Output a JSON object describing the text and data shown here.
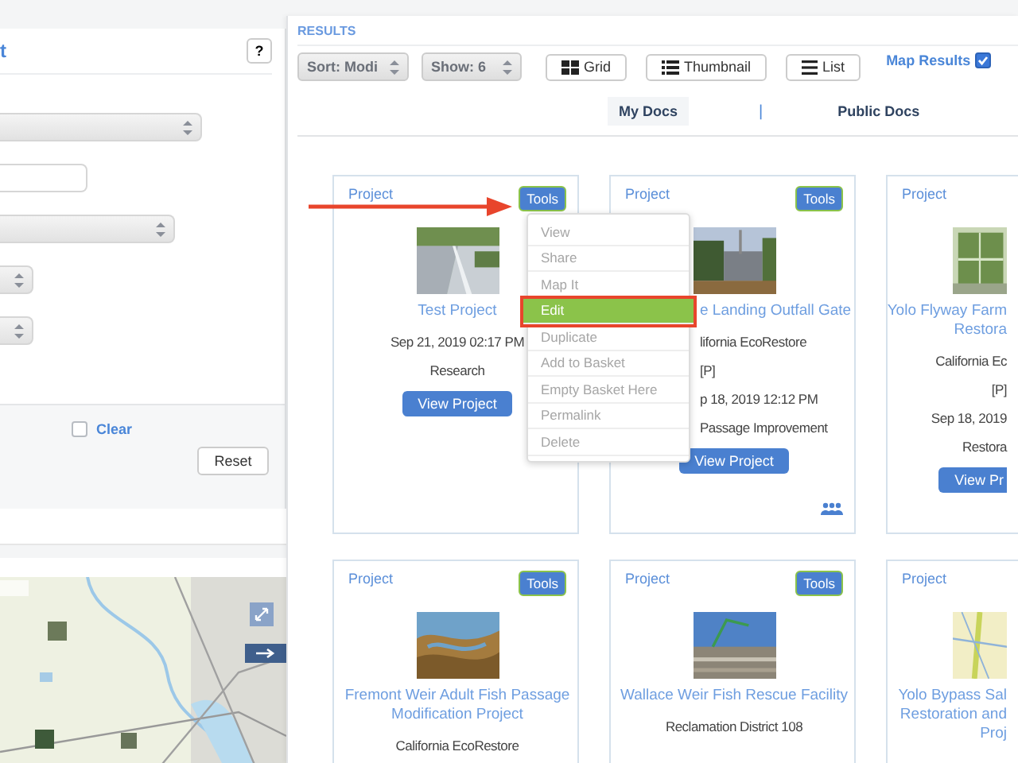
{
  "filter_panel": {
    "title": "t",
    "help_button": "?",
    "fields": [
      {
        "kind": "select"
      },
      {
        "kind": "text"
      },
      {
        "kind": "select"
      },
      {
        "kind": "select"
      },
      {
        "kind": "select"
      }
    ],
    "clear": {
      "label": "Clear",
      "checked": false
    },
    "reset_button": "Reset"
  },
  "results": {
    "heading": "RESULTS",
    "sort": "Sort: Modi",
    "show": "Show: 6",
    "view_buttons": [
      {
        "kind": "grid",
        "label": "Grid"
      },
      {
        "kind": "thumbnail",
        "label": "Thumbnail"
      },
      {
        "kind": "list",
        "label": "List"
      }
    ],
    "map_results": {
      "label": "Map Results",
      "checked": true
    },
    "tabs": [
      {
        "label": "My Docs",
        "selected": true
      },
      {
        "label": "Public Docs",
        "selected": false
      }
    ],
    "tab_separator": "|",
    "cards": [
      {
        "label": "Project",
        "tools": "Tools",
        "title": [
          "Test Project"
        ],
        "lines": [
          "Sep 21, 2019 02:17 PM",
          "Research"
        ],
        "button": "View Project",
        "team": false
      },
      {
        "label": "Project",
        "tools": "Tools",
        "title": [
          "e Landing Outfall Gate"
        ],
        "lines": [
          "lifornia EcoRestore",
          "[P]",
          "p 18, 2019 12:12 PM",
          "Passage Improvement"
        ],
        "button": "View Project",
        "team": true
      },
      {
        "label": "Project",
        "title": [
          "Yolo Flyway Farm",
          "Restora"
        ],
        "lines": [
          "California Ec",
          "[P]",
          "Sep 18, 2019",
          "Restora"
        ],
        "button": "View Pr",
        "team": false
      },
      {
        "label": "Project",
        "tools": "Tools",
        "title": [
          "Fremont Weir Adult Fish Passage",
          "Modification Project"
        ],
        "lines": [
          "California EcoRestore"
        ]
      },
      {
        "label": "Project",
        "tools": "Tools",
        "title": [
          "Wallace Weir Fish Rescue Facility"
        ],
        "lines": [
          "Reclamation District 108"
        ]
      },
      {
        "label": "Project",
        "title": [
          "Yolo Bypass Sal",
          "Restoration and",
          "Proj"
        ]
      }
    ],
    "menu": {
      "items": [
        {
          "label": "View",
          "selected": false,
          "outlined": false
        },
        {
          "label": "Share",
          "selected": false,
          "outlined": false
        },
        {
          "label": "Map It",
          "selected": false,
          "outlined": false
        },
        {
          "label": "Edit",
          "selected": true,
          "outlined": true
        },
        {
          "label": "Duplicate",
          "selected": false,
          "outlined": false
        },
        {
          "label": "Add to Basket",
          "selected": false,
          "outlined": false
        },
        {
          "label": "Empty Basket Here",
          "selected": false,
          "outlined": false
        },
        {
          "label": "Permalink",
          "selected": false,
          "outlined": false
        },
        {
          "label": "Delete",
          "selected": false,
          "outlined": false
        }
      ]
    }
  }
}
